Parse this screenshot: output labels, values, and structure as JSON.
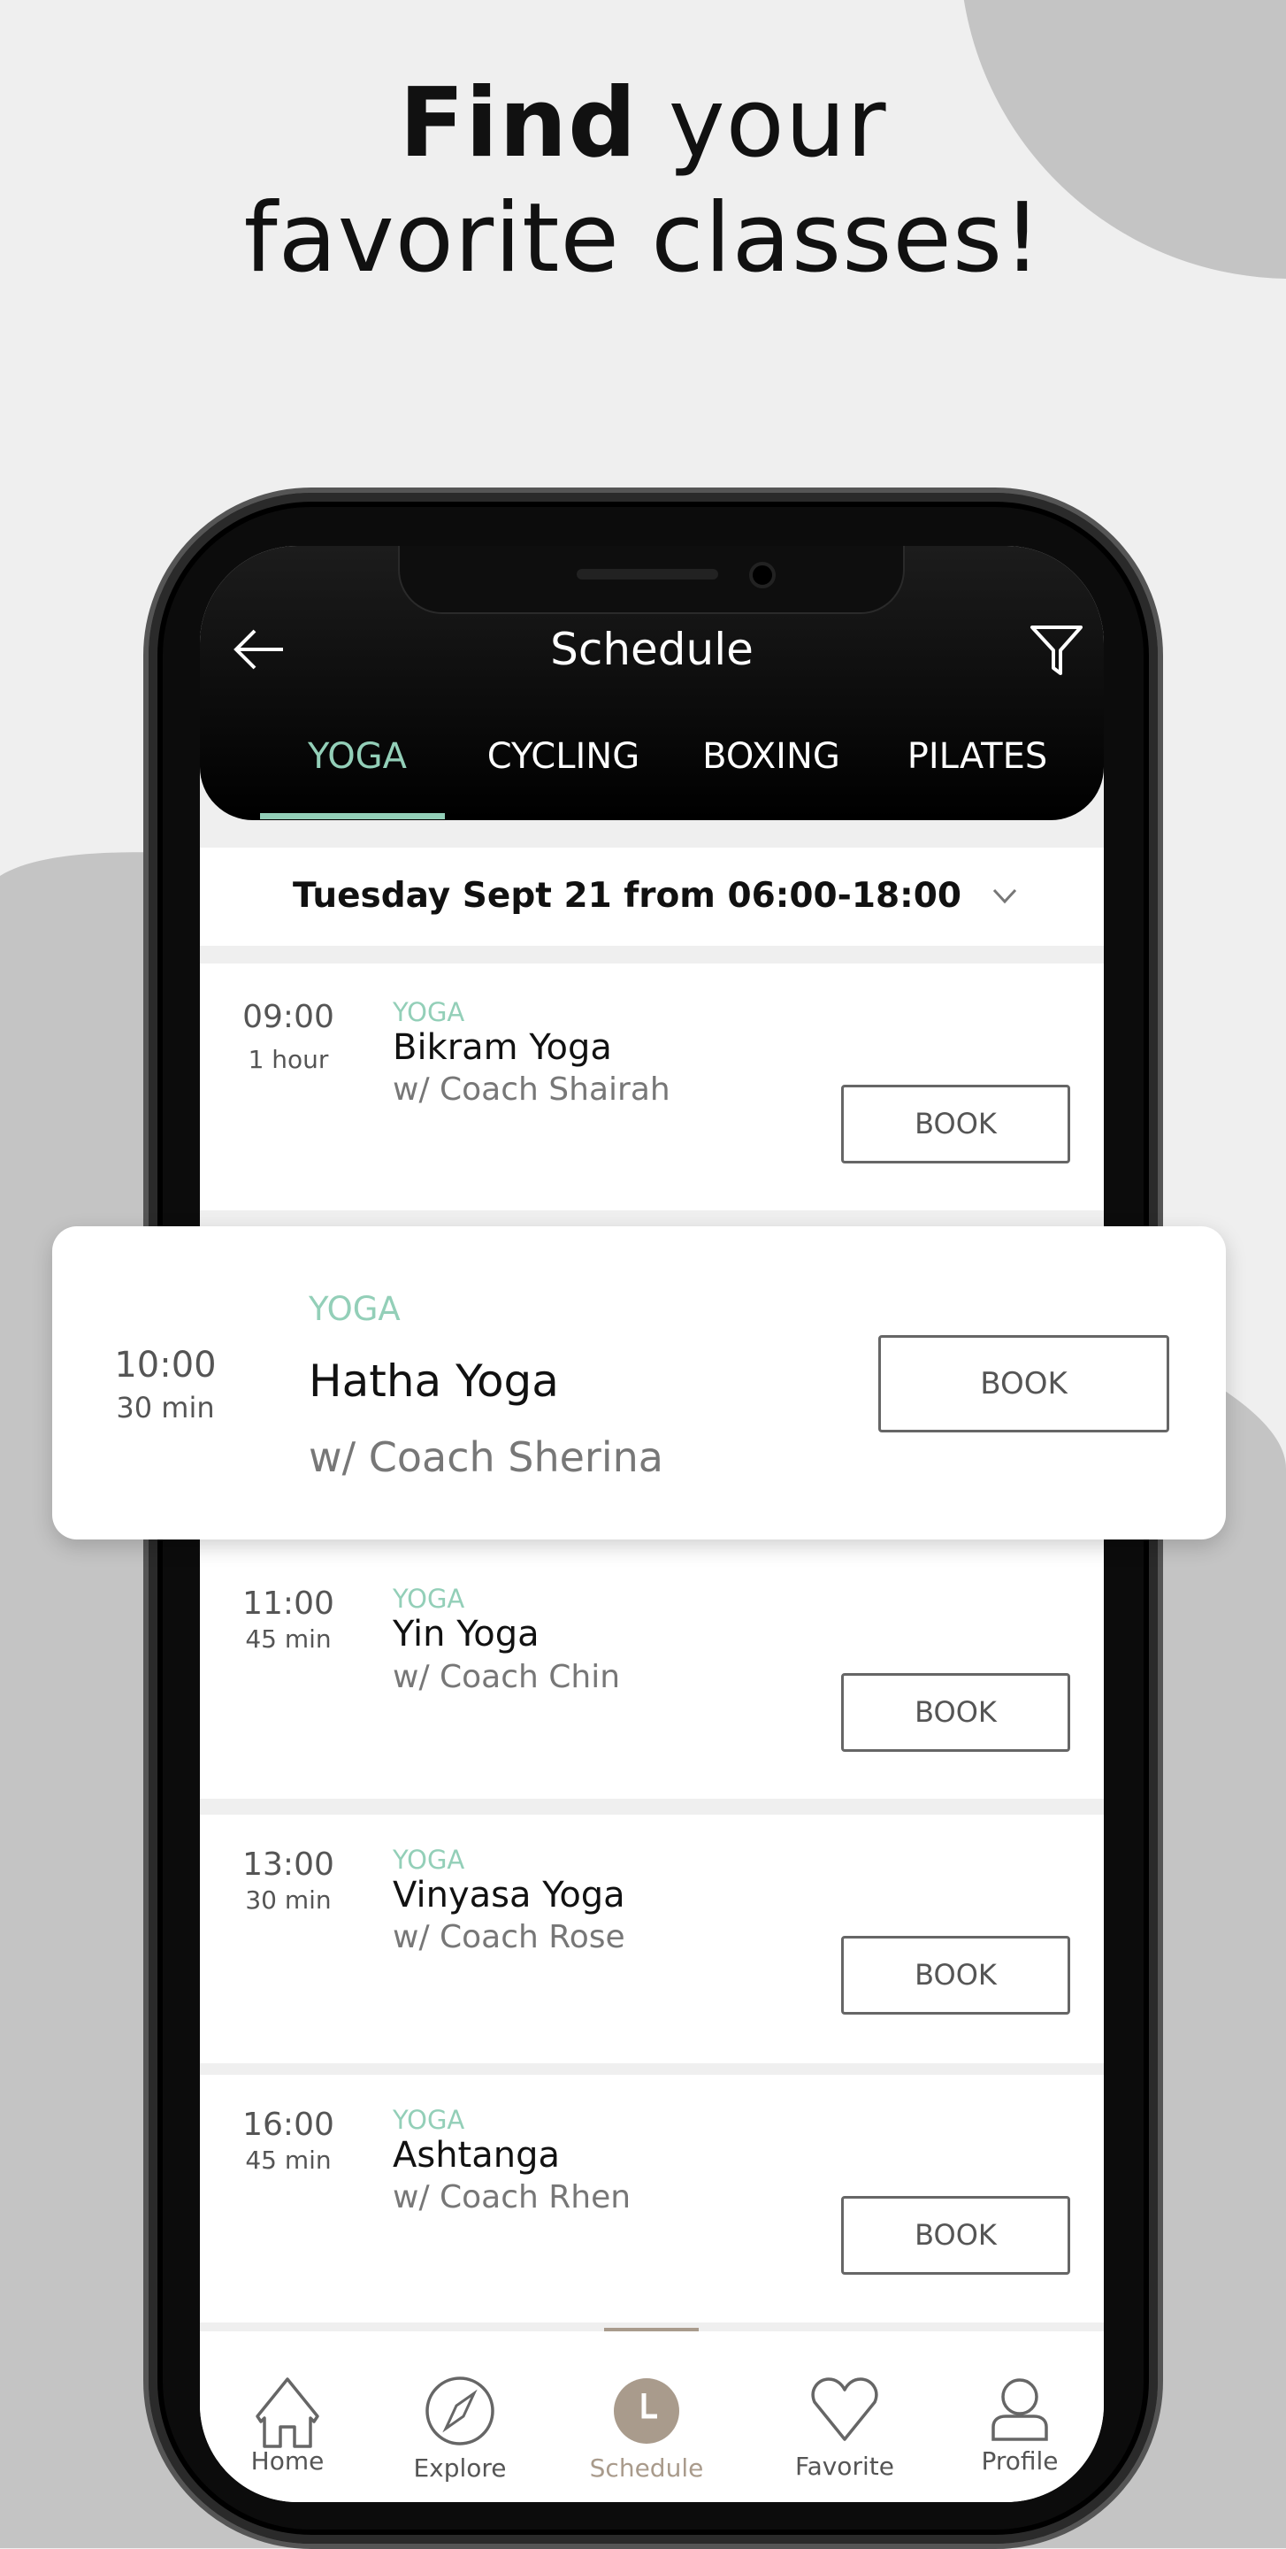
{
  "headline": {
    "line1_bold": "Find",
    "line1_rest": " your",
    "line2": "favorite classes!"
  },
  "colors": {
    "accent": "#93cfb8",
    "active_nav": "#a99b8c",
    "background": "#efefef",
    "decor": "#c4c4c4"
  },
  "header": {
    "title": "Schedule",
    "back_icon": "arrow-left-icon",
    "filter_icon": "filter-icon"
  },
  "tabs": [
    {
      "label": "YOGA",
      "active": true
    },
    {
      "label": "CYCLING"
    },
    {
      "label": "BOXING"
    },
    {
      "label": "PILATES"
    }
  ],
  "date_filter": {
    "label": "Tuesday Sept 21 from 06:00-18:00"
  },
  "classes": [
    {
      "time": "09:00",
      "duration": "1 hour",
      "category": "YOGA",
      "name": "Bikram Yoga",
      "coach": "w/ Coach Shairah",
      "button": "BOOK"
    },
    {
      "time": "10:00",
      "duration": "30 min",
      "category": "YOGA",
      "name": "Hatha Yoga",
      "coach": "w/ Coach Sherina",
      "button": "BOOK"
    },
    {
      "time": "11:00",
      "duration": "45 min",
      "category": "YOGA",
      "name": "Yin Yoga",
      "coach": "w/ Coach Chin",
      "button": "BOOK"
    },
    {
      "time": "13:00",
      "duration": "30 min",
      "category": "YOGA",
      "name": "Vinyasa Yoga",
      "coach": "w/ Coach Rose",
      "button": "BOOK"
    },
    {
      "time": "16:00",
      "duration": "45 min",
      "category": "YOGA",
      "name": "Ashtanga",
      "coach": "w/ Coach Rhen",
      "button": "BOOK"
    }
  ],
  "nav": [
    {
      "label": "Home"
    },
    {
      "label": "Explore"
    },
    {
      "label": "Schedule",
      "active": true
    },
    {
      "label": "Favorite"
    },
    {
      "label": "Profile"
    }
  ]
}
